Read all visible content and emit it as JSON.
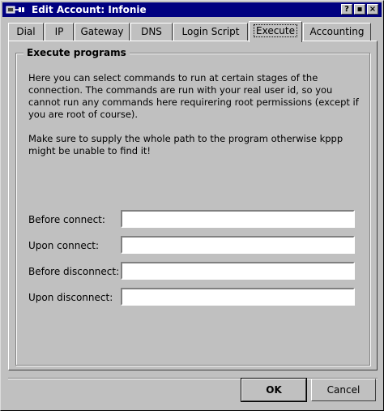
{
  "window": {
    "title": "Edit Account: Infonie",
    "controls": {
      "help": "?",
      "maximize": "▪",
      "close": "×"
    }
  },
  "tabs": [
    {
      "label": "Dial",
      "active": false
    },
    {
      "label": "IP",
      "active": false
    },
    {
      "label": "Gateway",
      "active": false
    },
    {
      "label": "DNS",
      "active": false
    },
    {
      "label": "Login Script",
      "active": false
    },
    {
      "label": "Execute",
      "active": true
    },
    {
      "label": "Accounting",
      "active": false
    }
  ],
  "execute": {
    "group_title": "Execute programs",
    "description1": "Here you can select commands to run at certain stages of the connection. The commands are run with your real user id, so you cannot run any commands here requirering root permissions (except if you are root of course).",
    "description2": "Make sure to supply the whole path to the program otherwise kppp might be unable to find it!",
    "fields": [
      {
        "label": "Before connect:",
        "value": ""
      },
      {
        "label": "Upon connect:",
        "value": ""
      },
      {
        "label": "Before disconnect:",
        "value": ""
      },
      {
        "label": "Upon disconnect:",
        "value": ""
      }
    ]
  },
  "buttons": {
    "ok": "OK",
    "cancel": "Cancel"
  }
}
